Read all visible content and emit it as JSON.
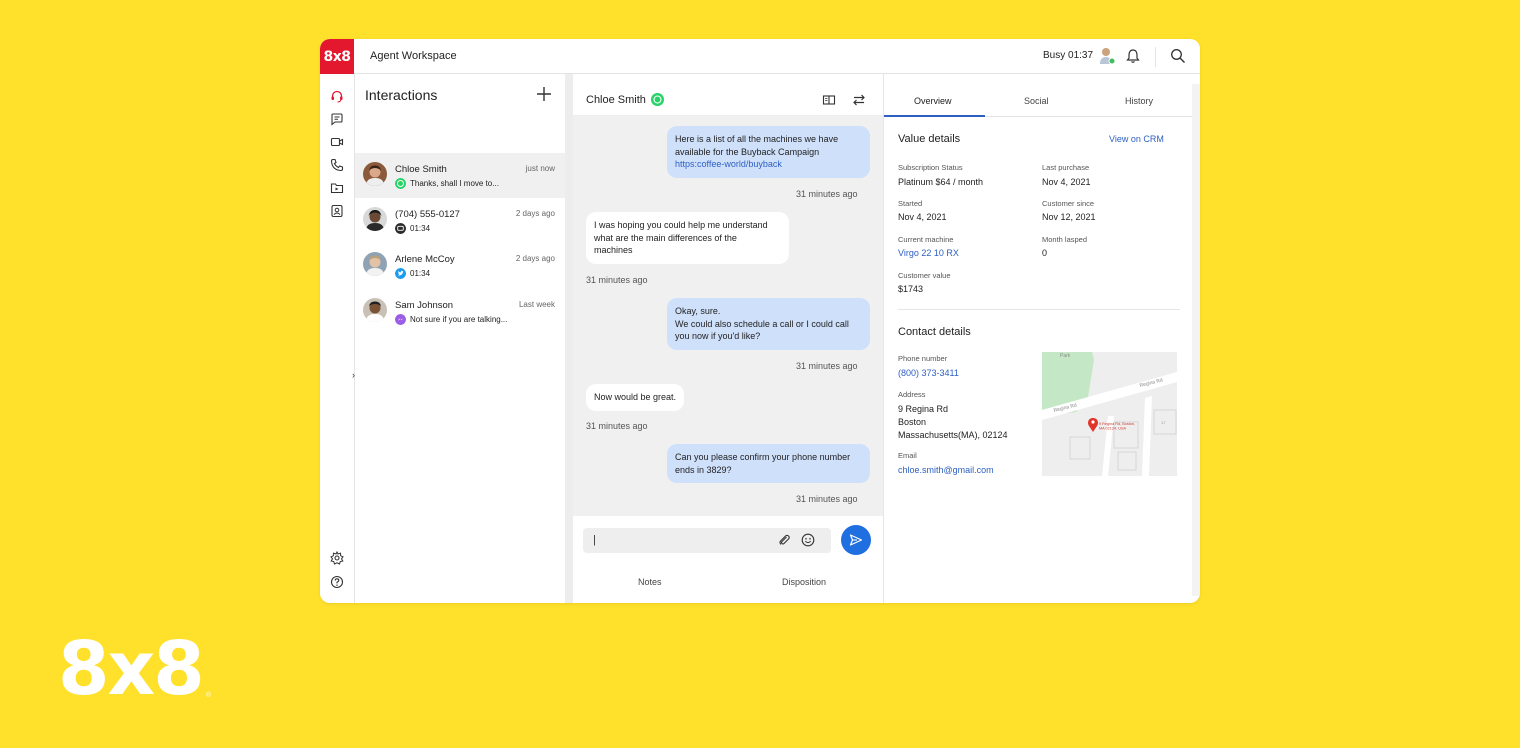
{
  "topbar": {
    "logo": "8x8",
    "title": "Agent Workspace",
    "status": "Busy 01:37"
  },
  "rail": {
    "icons": [
      "headset-icon",
      "chat-icon",
      "video-icon",
      "phone-icon",
      "folder-icon",
      "contacts-icon",
      "settings-icon",
      "help-icon"
    ],
    "collapse": "›"
  },
  "interactions": {
    "heading": "Interactions",
    "items": [
      {
        "name": "Chloe Smith",
        "time": "just now",
        "preview": "Thanks, shall I move to...",
        "channel": "whatsapp"
      },
      {
        "name": "(704) 555-0127",
        "time": "2 days ago",
        "preview": "01:34",
        "channel": "sms"
      },
      {
        "name": "Arlene McCoy",
        "time": "2 days ago",
        "preview": "01:34",
        "channel": "twitter"
      },
      {
        "name": "Sam Johnson",
        "time": "Last week",
        "preview": "Not sure if you are talking...",
        "channel": "messenger"
      }
    ]
  },
  "chat": {
    "contact": "Chloe Smith",
    "messages": [
      {
        "dir": "out",
        "lines": [
          "Here is a list of all the machines we have",
          "available for the Buyback Campaign"
        ],
        "link": "https:coffee-world/buyback",
        "time": "31 minutes ago"
      },
      {
        "dir": "in",
        "lines": [
          "I was hoping you could help me understand",
          "what are the main differences of the",
          "machines"
        ],
        "time": "31 minutes ago"
      },
      {
        "dir": "out",
        "lines": [
          "Okay, sure.",
          "We could also schedule a call or I could call",
          "you now if you'd like?"
        ],
        "time": "31 minutes ago"
      },
      {
        "dir": "in",
        "lines": [
          "Now would be great."
        ],
        "time": "31 minutes ago"
      },
      {
        "dir": "out",
        "lines": [
          "Can you please confirm your phone number",
          "ends in 3829?"
        ],
        "time": "31 minutes ago"
      }
    ],
    "input_value": "|",
    "bottom_tabs": [
      "Notes",
      "Disposition"
    ]
  },
  "panel": {
    "tabs": [
      "Overview",
      "Social",
      "History"
    ],
    "value_details": {
      "title": "Value details",
      "crm_link": "View on CRM",
      "fields": [
        {
          "label": "Subscription Status",
          "value": "Platinum  $64 / month"
        },
        {
          "label": "Last purchase",
          "value": "Nov 4, 2021"
        },
        {
          "label": "Started",
          "value": "Nov 4, 2021"
        },
        {
          "label": "Customer since",
          "value": "Nov 12, 2021"
        },
        {
          "label": "Current machine",
          "value": "Virgo 22 10 RX"
        },
        {
          "label": "Month lasped",
          "value": "0"
        },
        {
          "label": "Customer value",
          "value": "$1743"
        }
      ]
    },
    "contact_details": {
      "title": "Contact details",
      "phone_label": "Phone number",
      "phone": "(800) 373-3411",
      "address_label": "Address",
      "address_lines": [
        "9 Regina Rd",
        "Boston",
        "Massachusetts(MA), 02124"
      ],
      "email_label": "Email",
      "email": "chloe.smith@gmail.com",
      "map": {
        "park": "Park",
        "street1": "Regina Rd",
        "street2": "Regina Rd",
        "pin": "9 Regina Rd, Boston, MA 02124, USA",
        "parcel": "17"
      }
    }
  },
  "brand": {
    "logo": "8x8",
    "reg": "®"
  },
  "colors": {
    "background": "#FFE02A",
    "logo_red": "#E3172D",
    "accent": "#1F6FE0",
    "outgoing_bubble": "#CFE0FB",
    "link": "#2D5FC2"
  }
}
